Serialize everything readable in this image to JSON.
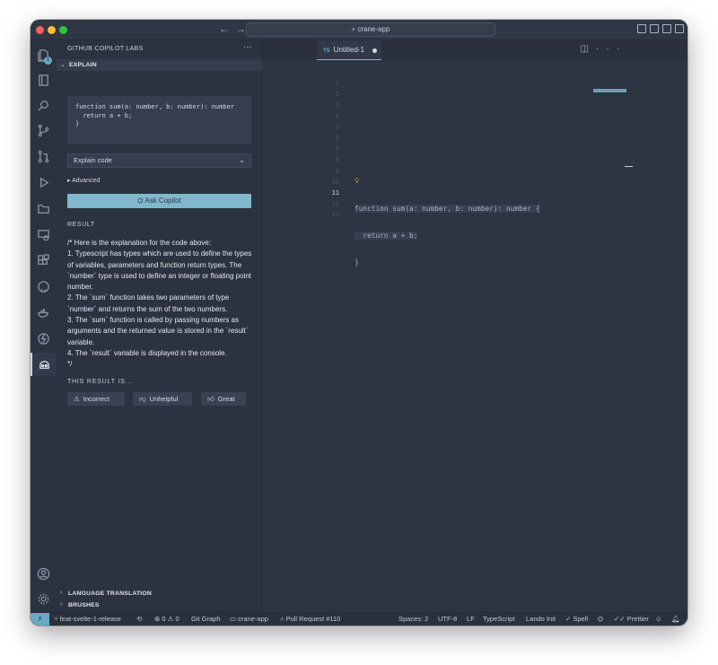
{
  "window": {
    "command_center": "crane-app"
  },
  "sidebar": {
    "title": "GITHUB COPILOT LABS",
    "explain_header": "EXPLAIN",
    "code_input": [
      "function sum(a: number, b: number): number",
      "  return a + b;",
      "}"
    ],
    "select_value": "Explain code",
    "advanced_label": "Advanced",
    "ask_button": "Ask Copilot",
    "result_label": "RESULT",
    "result_text": "/* Here is the explanation for the code above:\n1. Typescript has types which are used to define the types of variables, parameters and function return types. The `number` type is used to define an integer or floating point number.\n2. The `sum` function takes two parameters of type `number` and returns the sum of the two numbers.\n3. The `sum` function is called by passing numbers as arguments and the returned value is stored in the `result` variable.\n4. The `result` variable is displayed in the console.\n*/",
    "feedback_label": "THIS RESULT IS...",
    "feedback": {
      "incorrect": "Incorrect",
      "unhelpful": "Unhelpful",
      "great": "Great"
    },
    "sections": {
      "language_translation": "LANGUAGE TRANSLATION",
      "brushes": "BRUSHES"
    },
    "explorer_badge": "1"
  },
  "editor": {
    "tab_lang": "TS",
    "tab_name": "Untitled-1",
    "line_numbers": [
      "1",
      "2",
      "3",
      "4",
      "5",
      "6",
      "7",
      "8",
      "9",
      "10",
      "11",
      "12",
      "13"
    ],
    "current_line": "11",
    "code": [
      "function sum(a: number, b: number): number {",
      "  return a + b;",
      "}"
    ]
  },
  "statusbar": {
    "branch": "feat-svelte-1-release",
    "errors": "0",
    "warnings": "0",
    "git_graph": "Git Graph",
    "folder": "crane-app",
    "pull_request": "Pull Request #110",
    "spaces": "Spaces: 2",
    "encoding": "UTF-8",
    "eol": "LF",
    "language": "TypeScript",
    "lando": "Lando Init",
    "spell": "Spell",
    "prettier": "Prettier"
  },
  "colors": {
    "accent": "#7fb8cc",
    "background": "#2b3240",
    "editor_bg": "#2d3442"
  }
}
